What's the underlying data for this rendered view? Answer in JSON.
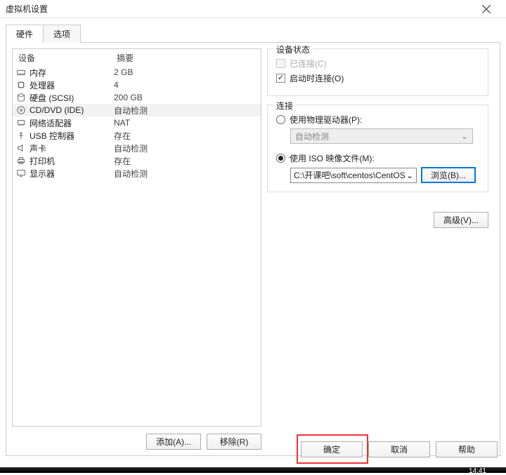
{
  "window": {
    "title": "虚拟机设置"
  },
  "tabs": {
    "hardware": "硬件",
    "options": "选项"
  },
  "device_table": {
    "header_device": "设备",
    "header_summary": "摘要",
    "rows": [
      {
        "icon": "memory-icon",
        "label": "内存",
        "summary": "2 GB"
      },
      {
        "icon": "cpu-icon",
        "label": "处理器",
        "summary": "4"
      },
      {
        "icon": "disk-icon",
        "label": "硬盘 (SCSI)",
        "summary": "200 GB"
      },
      {
        "icon": "disc-icon",
        "label": "CD/DVD (IDE)",
        "summary": "自动检测",
        "selected": true
      },
      {
        "icon": "nic-icon",
        "label": "网络适配器",
        "summary": "NAT"
      },
      {
        "icon": "usb-icon",
        "label": "USB 控制器",
        "summary": "存在"
      },
      {
        "icon": "sound-icon",
        "label": "声卡",
        "summary": "自动检测"
      },
      {
        "icon": "printer-icon",
        "label": "打印机",
        "summary": "存在"
      },
      {
        "icon": "display-icon",
        "label": "显示器",
        "summary": "自动检测"
      }
    ]
  },
  "device_buttons": {
    "add": "添加(A)...",
    "remove": "移除(R)"
  },
  "status_group": {
    "title": "设备状态",
    "connected": "已连接(C)",
    "connect_at_power_on": "启动时连接(O)"
  },
  "connection_group": {
    "title": "连接",
    "use_physical": "使用物理驱动器(P):",
    "physical_value": "自动检测",
    "use_iso": "使用 ISO 映像文件(M):",
    "iso_path": "C:\\开课吧\\soft\\centos\\CentOS",
    "browse": "浏览(B)..."
  },
  "advanced_button": "高级(V)...",
  "footer": {
    "ok": "确定",
    "cancel": "取消",
    "help": "帮助"
  },
  "taskbar_time": "14:41"
}
